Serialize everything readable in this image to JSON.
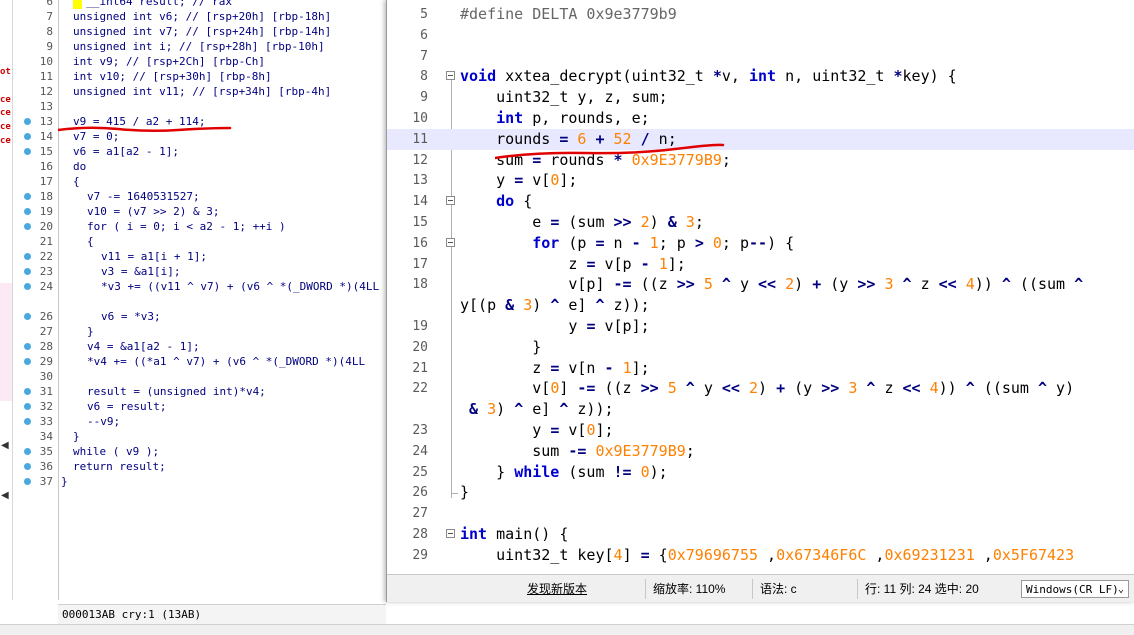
{
  "ida": {
    "status_text": "000013AB cry:1 (13AB)",
    "side_marks": [
      "ot",
      "ce",
      "ce",
      "ce",
      "ce"
    ],
    "lines": [
      {
        "n": "6",
        "code": "  __int64 result; // rax",
        "indent": "c-ind1",
        "dot": false
      },
      {
        "n": "7",
        "code": "unsigned int v6; // [rsp+20h] [rbp-18h]",
        "indent": "c-ind1",
        "dot": false
      },
      {
        "n": "8",
        "code": "unsigned int v7; // [rsp+24h] [rbp-14h]",
        "indent": "c-ind1",
        "dot": false
      },
      {
        "n": "9",
        "code": "unsigned int i; // [rsp+28h] [rbp-10h]",
        "indent": "c-ind1",
        "dot": false
      },
      {
        "n": "10",
        "code": "int v9; // [rsp+2Ch] [rbp-Ch]",
        "indent": "c-ind1",
        "dot": false
      },
      {
        "n": "11",
        "code": "int v10; // [rsp+30h] [rbp-8h]",
        "indent": "c-ind1",
        "dot": false
      },
      {
        "n": "12",
        "code": "unsigned int v11; // [rsp+34h] [rbp-4h]",
        "indent": "c-ind1",
        "dot": false
      },
      {
        "n": "13",
        "code": "",
        "indent": "c-ind1",
        "dot": false
      },
      {
        "n": "13",
        "code": "v9 = 415 / a2 + 114;",
        "indent": "c-ind1",
        "dot": true
      },
      {
        "n": "14",
        "code": "v7 = 0;",
        "indent": "c-ind1",
        "dot": true
      },
      {
        "n": "15",
        "code": "v6 = a1[a2 - 1];",
        "indent": "c-ind1",
        "dot": true
      },
      {
        "n": "16",
        "code": "do",
        "indent": "c-ind1",
        "dot": false
      },
      {
        "n": "17",
        "code": "{",
        "indent": "c-ind1",
        "dot": false
      },
      {
        "n": "18",
        "code": "v7 -= 1640531527;",
        "indent": "c-ind2",
        "dot": true
      },
      {
        "n": "19",
        "code": "v10 = (v7 >> 2) & 3;",
        "indent": "c-ind2",
        "dot": true
      },
      {
        "n": "20",
        "code": "for ( i = 0; i < a2 - 1; ++i )",
        "indent": "c-ind2",
        "dot": true
      },
      {
        "n": "21",
        "code": "{",
        "indent": "c-ind2",
        "dot": false
      },
      {
        "n": "22",
        "code": "v11 = a1[i + 1];",
        "indent": "c-ind3",
        "dot": true
      },
      {
        "n": "23",
        "code": "v3 = &a1[i];",
        "indent": "c-ind3",
        "dot": true
      },
      {
        "n": "24",
        "code": "*v3 += ((v11 ^ v7) + (v6 ^ *(_DWORD *)(4LL",
        "indent": "c-ind3",
        "dot": true
      },
      {
        "n": "",
        "code": "",
        "indent": "c-ind3",
        "dot": false
      },
      {
        "n": "26",
        "code": "v6 = *v3;",
        "indent": "c-ind3",
        "dot": true
      },
      {
        "n": "27",
        "code": "}",
        "indent": "c-ind2",
        "dot": false
      },
      {
        "n": "28",
        "code": "v4 = &a1[a2 - 1];",
        "indent": "c-ind2",
        "dot": true
      },
      {
        "n": "29",
        "code": "*v4 += ((*a1 ^ v7) + (v6 ^ *(_DWORD *)(4LL",
        "indent": "c-ind2",
        "dot": true
      },
      {
        "n": "30",
        "code": "",
        "indent": "c-ind2",
        "dot": false
      },
      {
        "n": "31",
        "code": "result = (unsigned int)*v4;",
        "indent": "c-ind2",
        "dot": true
      },
      {
        "n": "32",
        "code": "v6 = result;",
        "indent": "c-ind2",
        "dot": true
      },
      {
        "n": "33",
        "code": "--v9;",
        "indent": "c-ind2",
        "dot": true
      },
      {
        "n": "34",
        "code": "}",
        "indent": "c-ind1",
        "dot": false
      },
      {
        "n": "35",
        "code": "while ( v9 );",
        "indent": "c-ind1",
        "dot": true
      },
      {
        "n": "36",
        "code": "return result;",
        "indent": "c-ind1",
        "dot": true
      },
      {
        "n": "37",
        "code": "}",
        "indent": "c-top",
        "dot": true
      }
    ]
  },
  "editor": {
    "lines": [
      {
        "n": "5",
        "html": "<span class=\"pp\">#define DELTA 0x9e3779b9</span>",
        "fold": "",
        "cur": false
      },
      {
        "n": "6",
        "html": "",
        "fold": "",
        "cur": false
      },
      {
        "n": "7",
        "html": "",
        "fold": "",
        "cur": false
      },
      {
        "n": "8",
        "html": "<span class=\"kw\">void</span> xxtea_decrypt(uint32_t <span class=\"op\">*</span>v, <span class=\"kw\">int</span> n, uint32_t <span class=\"op\">*</span>key) {",
        "fold": "box",
        "cur": false
      },
      {
        "n": "9",
        "html": "    uint32_t y, z, sum;",
        "fold": "",
        "cur": false
      },
      {
        "n": "10",
        "html": "    <span class=\"kw\">int</span> p, rounds, e;",
        "fold": "",
        "cur": false
      },
      {
        "n": "11",
        "html": "    rounds <span class=\"op\">=</span> <span class=\"numc\">6</span> <span class=\"op\">+</span> <span class=\"numc\">52</span> <span class=\"op\">/</span> n;",
        "fold": "",
        "cur": true
      },
      {
        "n": "12",
        "html": "    sum <span class=\"op\">=</span> rounds <span class=\"op\">*</span> <span class=\"numc\">0x9E3779B9</span>;",
        "fold": "",
        "cur": false
      },
      {
        "n": "13",
        "html": "    y <span class=\"op\">=</span> v[<span class=\"numc\">0</span>];",
        "fold": "",
        "cur": false
      },
      {
        "n": "14",
        "html": "    <span class=\"kw\">do</span> {",
        "fold": "box",
        "cur": false
      },
      {
        "n": "15",
        "html": "        e <span class=\"op\">=</span> (sum <span class=\"op\">&gt;&gt;</span> <span class=\"numc\">2</span>) <span class=\"op\">&amp;</span> <span class=\"numc\">3</span>;",
        "fold": "",
        "cur": false
      },
      {
        "n": "16",
        "html": "        <span class=\"kw\">for</span> (p <span class=\"op\">=</span> n <span class=\"op\">-</span> <span class=\"numc\">1</span>; p <span class=\"op\">&gt;</span> <span class=\"numc\">0</span>; p<span class=\"op\">--</span>) {",
        "fold": "box",
        "cur": false
      },
      {
        "n": "17",
        "html": "            z <span class=\"op\">=</span> v[p <span class=\"op\">-</span> <span class=\"numc\">1</span>];",
        "fold": "",
        "cur": false
      },
      {
        "n": "18",
        "html": "            v[p] <span class=\"op\">-=</span> ((z <span class=\"op\">&gt;&gt;</span> <span class=\"numc\">5</span> <span class=\"op\">^</span> y <span class=\"op\">&lt;&lt;</span> <span class=\"numc\">2</span>) <span class=\"op\">+</span> (y <span class=\"op\">&gt;&gt;</span> <span class=\"numc\">3</span> <span class=\"op\">^</span> z <span class=\"op\">&lt;&lt;</span> <span class=\"numc\">4</span>)) <span class=\"op\">^</span> ((sum <span class=\"op\">^</span>",
        "fold": "",
        "cur": false
      },
      {
        "n": "",
        "html": "y[(p <span class=\"op\">&amp;</span> <span class=\"numc\">3</span>) <span class=\"op\">^</span> e] <span class=\"op\">^</span> z));",
        "fold": "",
        "cur": false,
        "wrap": true
      },
      {
        "n": "19",
        "html": "            y <span class=\"op\">=</span> v[p];",
        "fold": "",
        "cur": false
      },
      {
        "n": "20",
        "html": "        }",
        "fold": "",
        "cur": false
      },
      {
        "n": "21",
        "html": "        z <span class=\"op\">=</span> v[n <span class=\"op\">-</span> <span class=\"numc\">1</span>];",
        "fold": "",
        "cur": false
      },
      {
        "n": "22",
        "html": "        v[<span class=\"numc\">0</span>] <span class=\"op\">-=</span> ((z <span class=\"op\">&gt;&gt;</span> <span class=\"numc\">5</span> <span class=\"op\">^</span> y <span class=\"op\">&lt;&lt;</span> <span class=\"numc\">2</span>) <span class=\"op\">+</span> (y <span class=\"op\">&gt;&gt;</span> <span class=\"numc\">3</span> <span class=\"op\">^</span> z <span class=\"op\">&lt;&lt;</span> <span class=\"numc\">4</span>)) <span class=\"op\">^</span> ((sum <span class=\"op\">^</span> y)",
        "fold": "",
        "cur": false
      },
      {
        "n": "",
        "html": " <span class=\"op\">&amp;</span> <span class=\"numc\">3</span>) <span class=\"op\">^</span> e] <span class=\"op\">^</span> z));",
        "fold": "",
        "cur": false,
        "wrap": true
      },
      {
        "n": "23",
        "html": "        y <span class=\"op\">=</span> v[<span class=\"numc\">0</span>];",
        "fold": "",
        "cur": false
      },
      {
        "n": "24",
        "html": "        sum <span class=\"op\">-=</span> <span class=\"numc\">0x9E3779B9</span>;",
        "fold": "",
        "cur": false
      },
      {
        "n": "25",
        "html": "    } <span class=\"kw\">while</span> (sum <span class=\"op\">!=</span> <span class=\"numc\">0</span>);",
        "fold": "",
        "cur": false
      },
      {
        "n": "26",
        "html": "}",
        "fold": "end",
        "cur": false
      },
      {
        "n": "27",
        "html": "",
        "fold": "",
        "cur": false
      },
      {
        "n": "28",
        "html": "<span class=\"kw\">int</span> main() {",
        "fold": "box",
        "cur": false
      },
      {
        "n": "29",
        "html": "    uint32_t key[<span class=\"numc\">4</span>] <span class=\"op\">=</span> {<span class=\"numc\">0x79696755</span> ,<span class=\"numc\">0x67346F6C</span> ,<span class=\"numc\">0x69231231</span> ,<span class=\"numc\">0x5F67423</span>",
        "fold": "",
        "cur": false
      }
    ],
    "status": {
      "new_version": "发现新版本",
      "zoom": "缩放率: 110%",
      "language": "语法: c",
      "position": "行: 11 列: 24 选中: 20",
      "eol": "Windows(CR LF)"
    }
  },
  "colors": {
    "annotation_red": "#e00000",
    "keyword": "#0000cc",
    "number": "#ff8000",
    "breakpoint_dot": "#48a8e0"
  }
}
